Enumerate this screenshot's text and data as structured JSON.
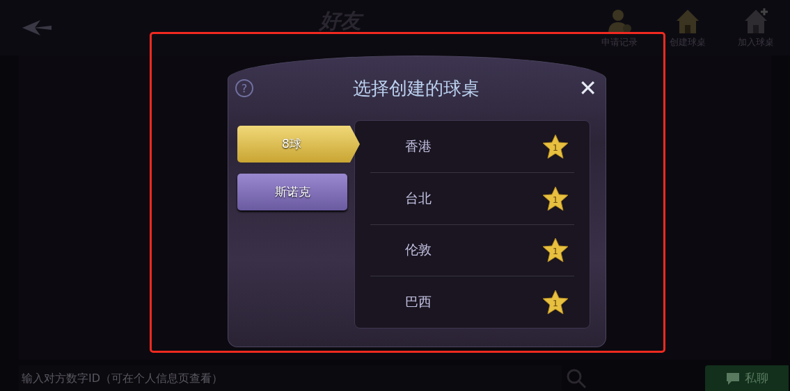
{
  "top_bar": {
    "title": "好友",
    "actions": [
      {
        "kind": "person",
        "label": "申请记录"
      },
      {
        "kind": "house",
        "label": "创建球桌"
      },
      {
        "kind": "house-plus",
        "label": "加入球桌"
      }
    ]
  },
  "bottom_bar": {
    "search": {
      "placeholder": "输入对方数字ID（可在个人信息页查看）"
    },
    "chat_button": "私聊"
  },
  "dialog": {
    "help": "?",
    "title": "选择创建的球桌",
    "close": "✕",
    "tabs": [
      {
        "label": "8球",
        "selected": true
      },
      {
        "label": "斯诺克",
        "selected": false
      }
    ],
    "tables": [
      {
        "name": "香港",
        "badge": "1"
      },
      {
        "name": "台北",
        "badge": "1"
      },
      {
        "name": "伦敦",
        "badge": "1"
      },
      {
        "name": "巴西",
        "badge": "1"
      }
    ]
  }
}
